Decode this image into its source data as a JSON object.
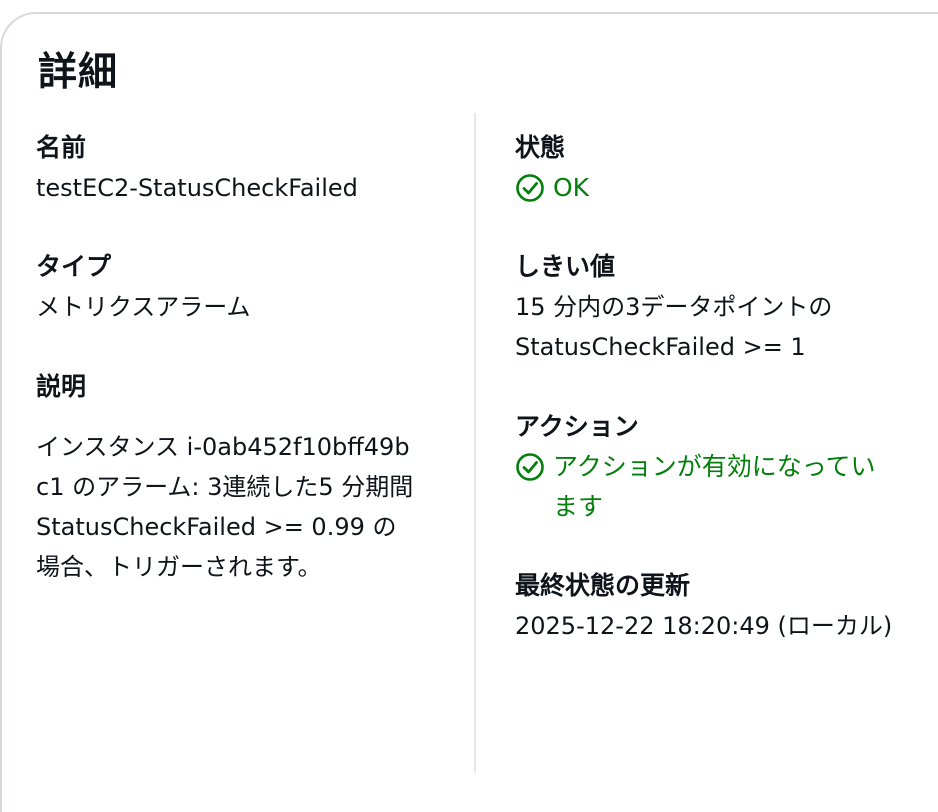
{
  "panel": {
    "title": "詳細"
  },
  "left": {
    "name": {
      "label": "名前",
      "value": "testEC2-StatusCheckFailed"
    },
    "type": {
      "label": "タイプ",
      "value": "メトリクスアラーム"
    },
    "description": {
      "label": "説明",
      "value": "インスタンス i-0ab452f10bff49bc1 のアラーム: 3連続した5 分期間 StatusCheckFailed >= 0.99 の場合、トリガーされます。"
    }
  },
  "right": {
    "state": {
      "label": "状態",
      "value": "OK",
      "icon": "check-circle-icon",
      "color": "#037f0c"
    },
    "threshold": {
      "label": "しきい値",
      "value": "15 分内の3データポイントの StatusCheckFailed >= 1"
    },
    "actions": {
      "label": "アクション",
      "value": "アクションが有効になっています",
      "icon": "check-circle-icon",
      "color": "#037f0c"
    },
    "last_updated": {
      "label": "最終状態の更新",
      "value": "2025-12-22 18:20:49 (ローカル)"
    }
  }
}
